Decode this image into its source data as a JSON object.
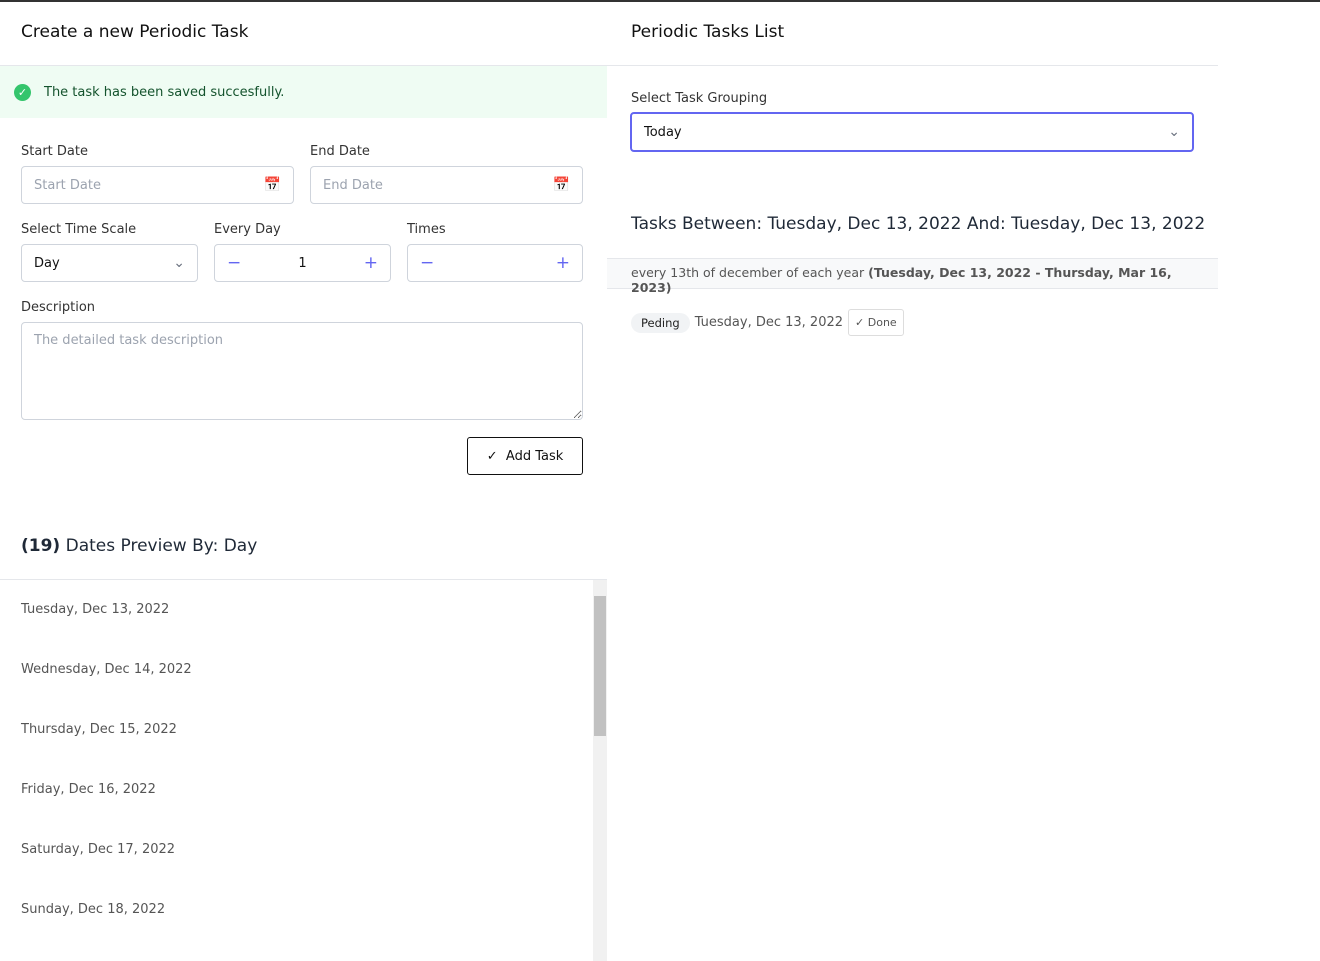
{
  "left": {
    "title": "Create a new Periodic Task",
    "alert": "The task has been saved succesfully.",
    "start_label": "Start Date",
    "start_ph": "Start Date",
    "end_label": "End Date",
    "end_ph": "End Date",
    "scale_label": "Select Time Scale",
    "scale_value": "Day",
    "every_label": "Every Day",
    "every_value": "1",
    "times_label": "Times",
    "times_value": "",
    "desc_label": "Description",
    "desc_ph": "The detailed task description",
    "add_label": "Add Task",
    "preview_count": "(19)",
    "preview_label": "Dates Preview By: Day",
    "dates": [
      "Tuesday, Dec 13, 2022",
      "Wednesday, Dec 14, 2022",
      "Thursday, Dec 15, 2022",
      "Friday, Dec 16, 2022",
      "Saturday, Dec 17, 2022",
      "Sunday, Dec 18, 2022"
    ]
  },
  "right": {
    "title": "Periodic Tasks List",
    "grouping_label": "Select Task Grouping",
    "grouping_value": "Today",
    "between": "Tasks Between: Tuesday, Dec 13, 2022 And: Tuesday, Dec 13, 2022",
    "rule_text": "every 13th of december of each year",
    "rule_range": "(Tuesday, Dec 13, 2022 - Thursday, Mar 16, 2023)",
    "task": {
      "status": "Peding",
      "date": "Tuesday, Dec 13, 2022",
      "done_label": "Done"
    }
  }
}
